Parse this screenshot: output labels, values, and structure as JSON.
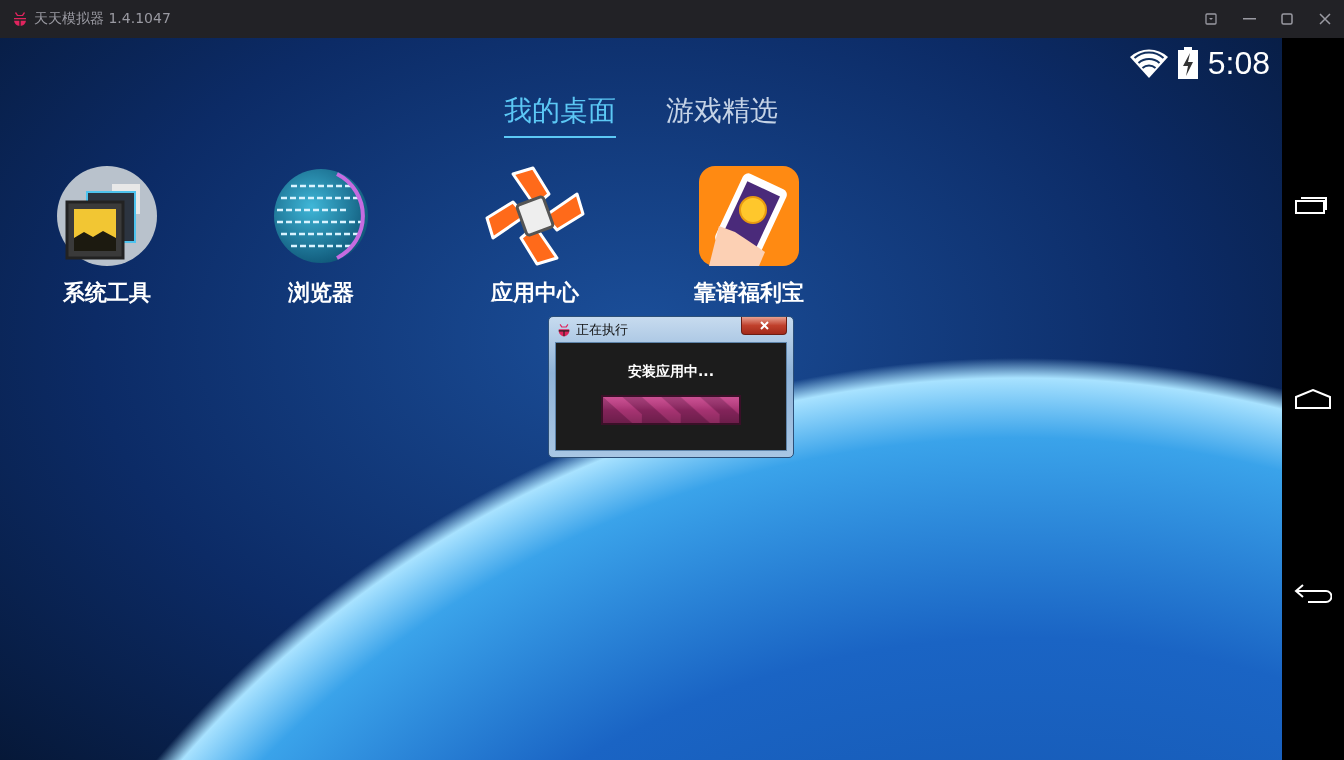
{
  "window": {
    "title": "天天模拟器 1.4.1047"
  },
  "status_bar": {
    "time": "5:08"
  },
  "tabs": [
    {
      "label": "我的桌面",
      "selected": true
    },
    {
      "label": "游戏精选",
      "selected": false
    }
  ],
  "apps": [
    {
      "label": "系统工具",
      "kind": "tools"
    },
    {
      "label": "浏览器",
      "kind": "browser"
    },
    {
      "label": "应用中心",
      "kind": "store"
    },
    {
      "label": "靠谱福利宝",
      "kind": "wallet"
    }
  ],
  "dialog": {
    "title": "正在执行",
    "message": "安装应用中...",
    "progress": {
      "level": 1
    }
  }
}
